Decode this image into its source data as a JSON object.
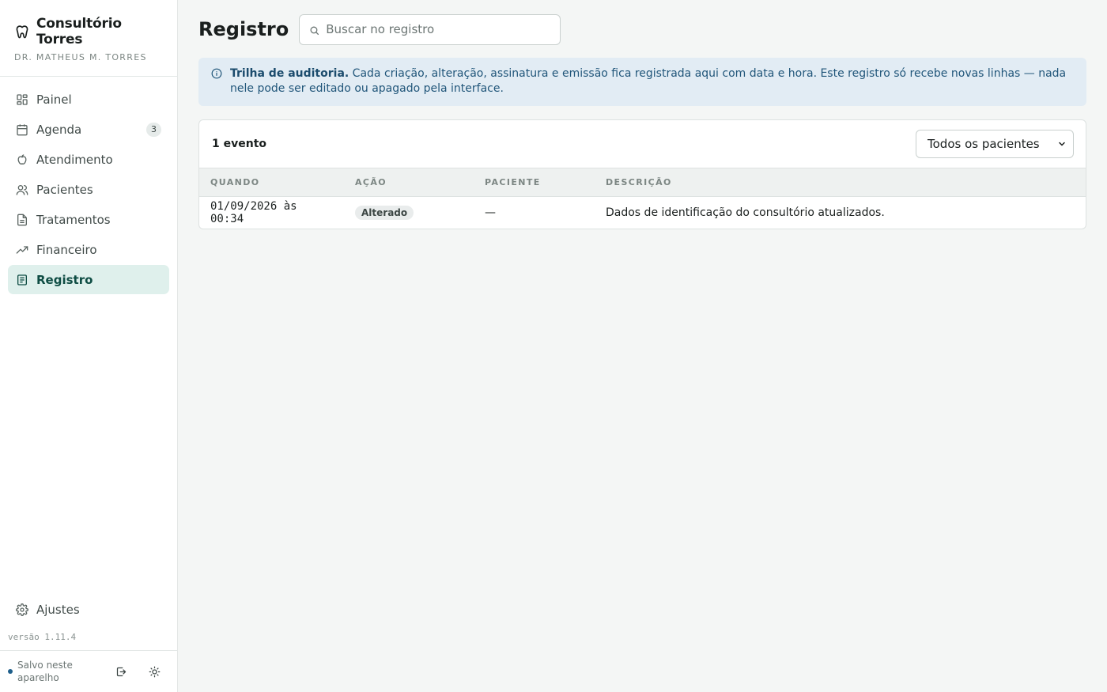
{
  "app": {
    "name": "Consultório Torres",
    "subtitle": "DR. MATHEUS M. TORRES",
    "logo_icon": "tooth-icon"
  },
  "sidebar": {
    "items": [
      {
        "label": "Painel",
        "icon": "grid-icon"
      },
      {
        "label": "Agenda",
        "icon": "calendar-icon",
        "badge": "3"
      },
      {
        "label": "Atendimento",
        "icon": "apple-icon"
      },
      {
        "label": "Pacientes",
        "icon": "users-icon"
      },
      {
        "label": "Tratamentos",
        "icon": "document-icon"
      },
      {
        "label": "Financeiro",
        "icon": "trending-up-icon"
      },
      {
        "label": "Registro",
        "icon": "log-icon",
        "active": true
      }
    ],
    "settings_label": "Ajustes",
    "version": "versão 1.11.4",
    "saved_status": "Salvo neste aparelho"
  },
  "header": {
    "title": "Registro",
    "search_placeholder": "Buscar no registro"
  },
  "alert": {
    "title": "Trilha de auditoria.",
    "text": "Cada criação, alteração, assinatura e emissão fica registrada aqui com data e hora. Este registro só recebe novas linhas — nada nele pode ser editado ou apagado pela interface."
  },
  "log": {
    "count": "1 evento",
    "filter_selected": "Todos os pacientes",
    "columns": [
      "QUANDO",
      "AÇÃO",
      "PACIENTE",
      "DESCRIÇÃO"
    ],
    "rows": [
      {
        "when": "01/09/2026 às 00:34",
        "action": "Alterado",
        "patient": "—",
        "description": "Dados de identificação do consultório atualizados."
      }
    ]
  },
  "colors": {
    "accent": "#0f4d44",
    "active_bg": "#dff0ec",
    "info_bg": "#e2ecf4",
    "info_text": "#21567a"
  }
}
